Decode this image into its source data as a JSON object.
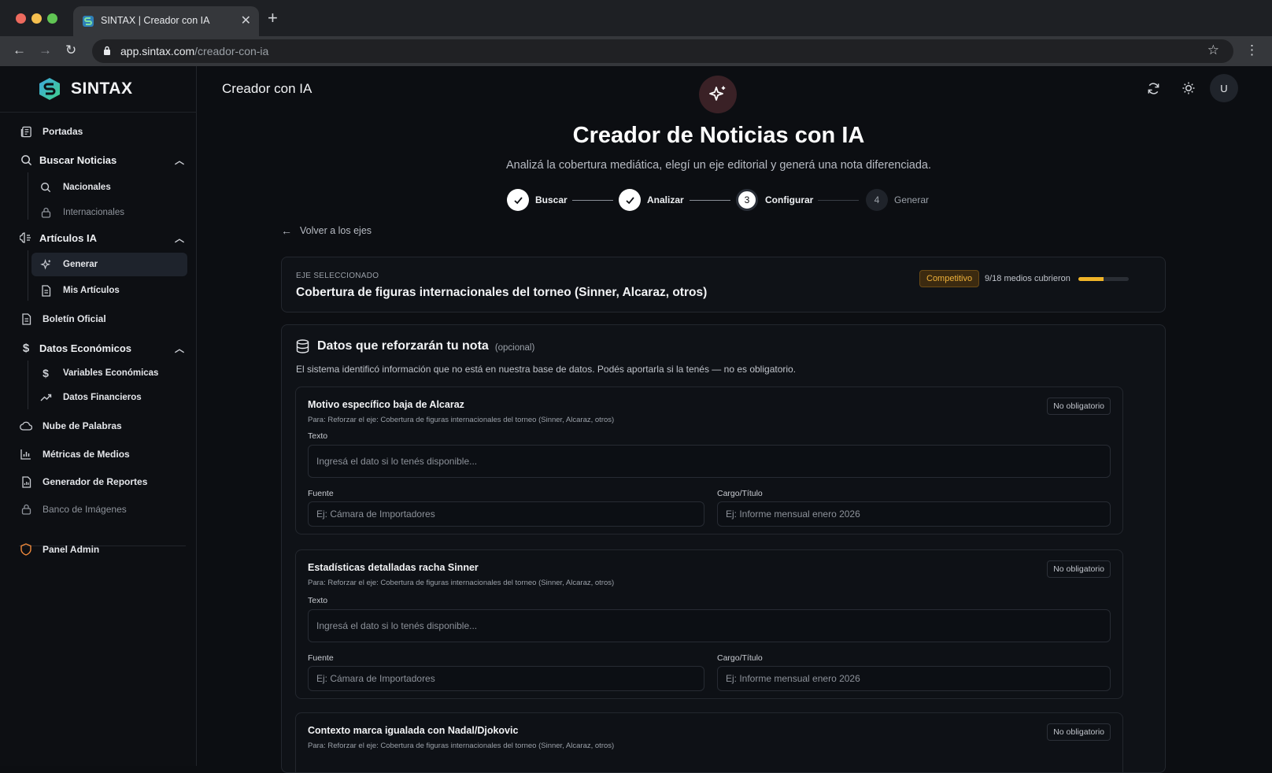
{
  "browser": {
    "tab_title": "SINTAX | Creador con IA",
    "url_host": "app.sintax.com",
    "url_path": "/creador-con-ia"
  },
  "brand": {
    "name": "SINTAX"
  },
  "sidebar": {
    "portadas": "Portadas",
    "buscar_noticias": "Buscar Noticias",
    "nacionales": "Nacionales",
    "internacionales": "Internacionales",
    "articulos_ia": "Artículos IA",
    "generar": "Generar",
    "mis_articulos": "Mis Artículos",
    "boletin": "Boletín Oficial",
    "datos_economicos": "Datos Económicos",
    "variables": "Variables Económicas",
    "financieros": "Datos Financieros",
    "nube": "Nube de Palabras",
    "metricas": "Métricas de Medios",
    "reportes": "Generador de Reportes",
    "banco": "Banco de Imágenes",
    "admin": "Panel Admin"
  },
  "header": {
    "title": "Creador con IA",
    "avatar_initial": "U"
  },
  "hero": {
    "title": "Creador de Noticias con IA",
    "subtitle": "Analizá la cobertura mediática, elegí un eje editorial y generá una nota diferenciada."
  },
  "steps": [
    {
      "label": "Buscar",
      "state": "done"
    },
    {
      "label": "Analizar",
      "state": "done"
    },
    {
      "num": "3",
      "label": "Configurar",
      "state": "current"
    },
    {
      "num": "4",
      "label": "Generar",
      "state": "todo"
    }
  ],
  "back_link": "Volver a los ejes",
  "selected_axis": {
    "label": "EJE SELECCIONADO",
    "title": "Cobertura de figuras internacionales del torneo (Sinner, Alcaraz, otros)",
    "badge": "Competitivo",
    "coverage_text": "9/18 medios cubrieron",
    "coverage_fraction": 0.5,
    "badge_color": "#f0b23a"
  },
  "data_section": {
    "title": "Datos que reforzarán tu nota",
    "optional": "(opcional)",
    "description": "El sistema identificó información que no está en nuestra base de datos. Podés aportarla si la tenés — no es obligatorio.",
    "items": [
      {
        "title": "Motivo específico baja de Alcaraz",
        "para": "Para: Reforzar el eje: Cobertura de figuras internacionales del torneo (Sinner, Alcaraz, otros)",
        "badge": "No obligatorio",
        "text_label": "Texto",
        "text_placeholder": "Ingresá el dato si lo tenés disponible...",
        "source_label": "Fuente",
        "source_placeholder": "Ej: Cámara de Importadores",
        "role_label": "Cargo/Título",
        "role_placeholder": "Ej: Informe mensual enero 2026"
      },
      {
        "title": "Estadísticas detalladas racha Sinner",
        "para": "Para: Reforzar el eje: Cobertura de figuras internacionales del torneo (Sinner, Alcaraz, otros)",
        "badge": "No obligatorio",
        "text_label": "Texto",
        "text_placeholder": "Ingresá el dato si lo tenés disponible...",
        "source_label": "Fuente",
        "source_placeholder": "Ej: Cámara de Importadores",
        "role_label": "Cargo/Título",
        "role_placeholder": "Ej: Informe mensual enero 2026"
      },
      {
        "title": "Contexto marca igualada con Nadal/Djokovic",
        "para": "Para: Reforzar el eje: Cobertura de figuras internacionales del torneo (Sinner, Alcaraz, otros)",
        "badge": "No obligatorio"
      }
    ]
  }
}
